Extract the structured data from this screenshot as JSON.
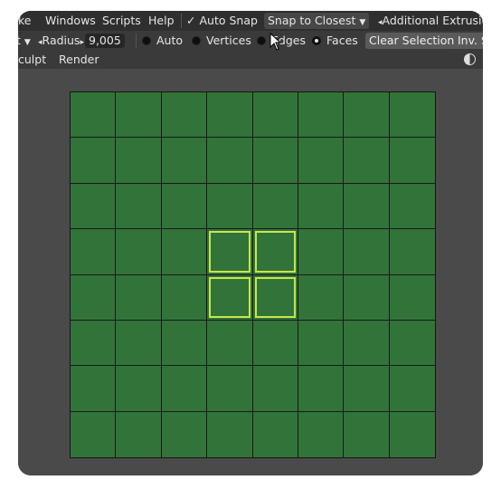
{
  "menubar": {
    "items": [
      "ke",
      "Windows",
      "Scripts",
      "Help"
    ],
    "auto_snap": "Auto Snap",
    "snap_dropdown": "Snap to Closest",
    "additional": "Additional Extrusio"
  },
  "toolbar": {
    "partial_label": "t",
    "radius_label": "Radius",
    "radius_value": "9,005",
    "options": [
      {
        "label": "Auto",
        "selected": false
      },
      {
        "label": "Vertices",
        "selected": false
      },
      {
        "label": "Edges",
        "selected": false
      },
      {
        "label": "Faces",
        "selected": true
      }
    ],
    "clear_selection": "Clear Selection",
    "inv": "Inv. S"
  },
  "modebar": {
    "items": [
      "culpt",
      "Render"
    ]
  },
  "viewport": {
    "grid_rows": 8,
    "grid_cols": 8,
    "face_color": "#317339",
    "selection_color": "#c8e64a",
    "selected_faces": [
      [
        3,
        3
      ],
      [
        3,
        4
      ],
      [
        4,
        3
      ],
      [
        4,
        4
      ]
    ]
  }
}
